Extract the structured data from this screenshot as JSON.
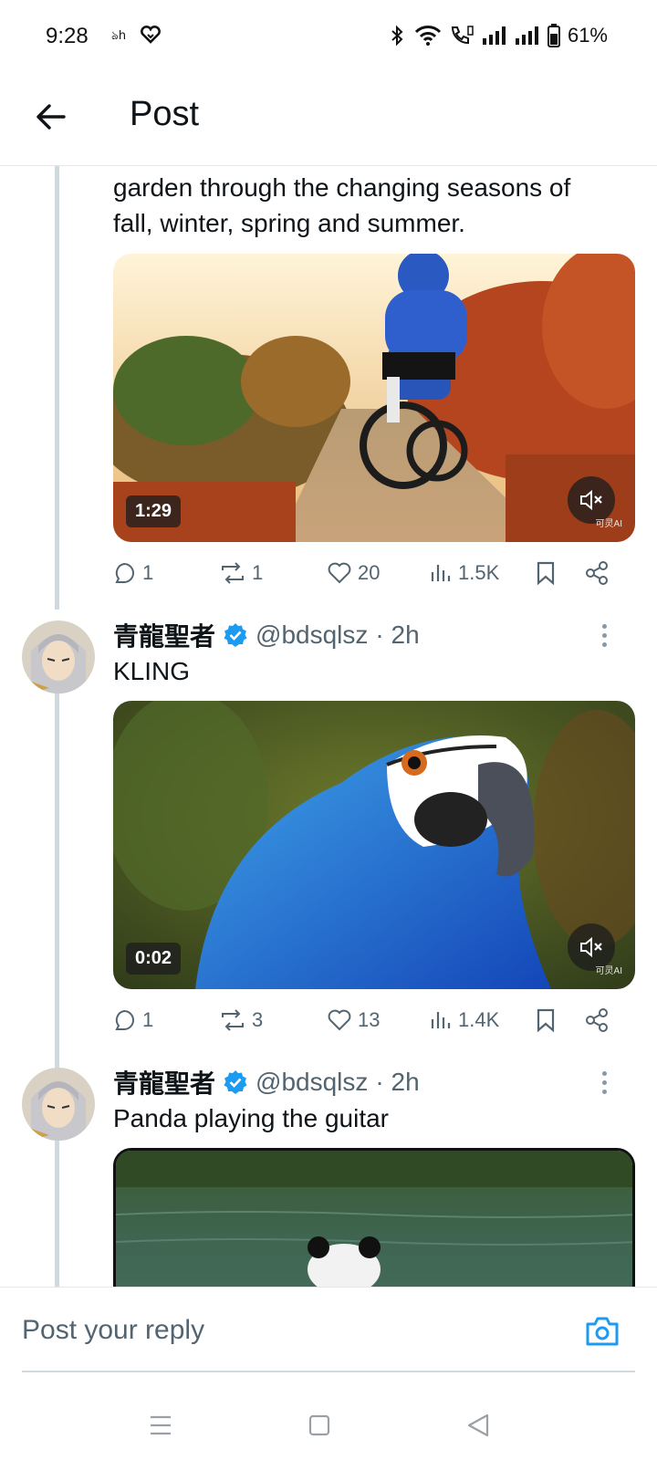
{
  "status_bar": {
    "time": "9:28",
    "battery": "61%",
    "left_icons": [
      "notification-icon",
      "heart-app-icon"
    ],
    "right_icons": [
      "bluetooth-icon",
      "wifi-icon",
      "call-icon",
      "signal-icon",
      "signal-icon",
      "battery-icon"
    ]
  },
  "header": {
    "title": "Post",
    "back_icon": "arrow-left-icon"
  },
  "posts": [
    {
      "text_lines": [
        "garden through the changing seasons of",
        "fall, winter, spring and summer."
      ],
      "media": {
        "duration": "1:29",
        "watermark": "可灵AI",
        "description_icon": "video-thumbnail"
      },
      "stats": {
        "replies": "1",
        "reposts": "1",
        "likes": "20",
        "views": "1.5K"
      }
    },
    {
      "author": {
        "name": "青龍聖者",
        "handle": "@bdsqlsz",
        "time": "· 2h"
      },
      "text": "KLING",
      "media": {
        "duration": "0:02",
        "watermark": "可灵AI"
      },
      "stats": {
        "replies": "1",
        "reposts": "3",
        "likes": "13",
        "views": "1.4K"
      }
    },
    {
      "author": {
        "name": "青龍聖者",
        "handle": "@bdsqlsz",
        "time": "· 2h"
      },
      "text": "Panda playing the guitar"
    }
  ],
  "reply_bar": {
    "placeholder": "Post your reply",
    "camera_icon": "camera-icon"
  },
  "colors": {
    "accent": "#1d9bf0",
    "text_primary": "#0f1419",
    "text_secondary": "#536471",
    "thread_line": "#cfd9de"
  }
}
